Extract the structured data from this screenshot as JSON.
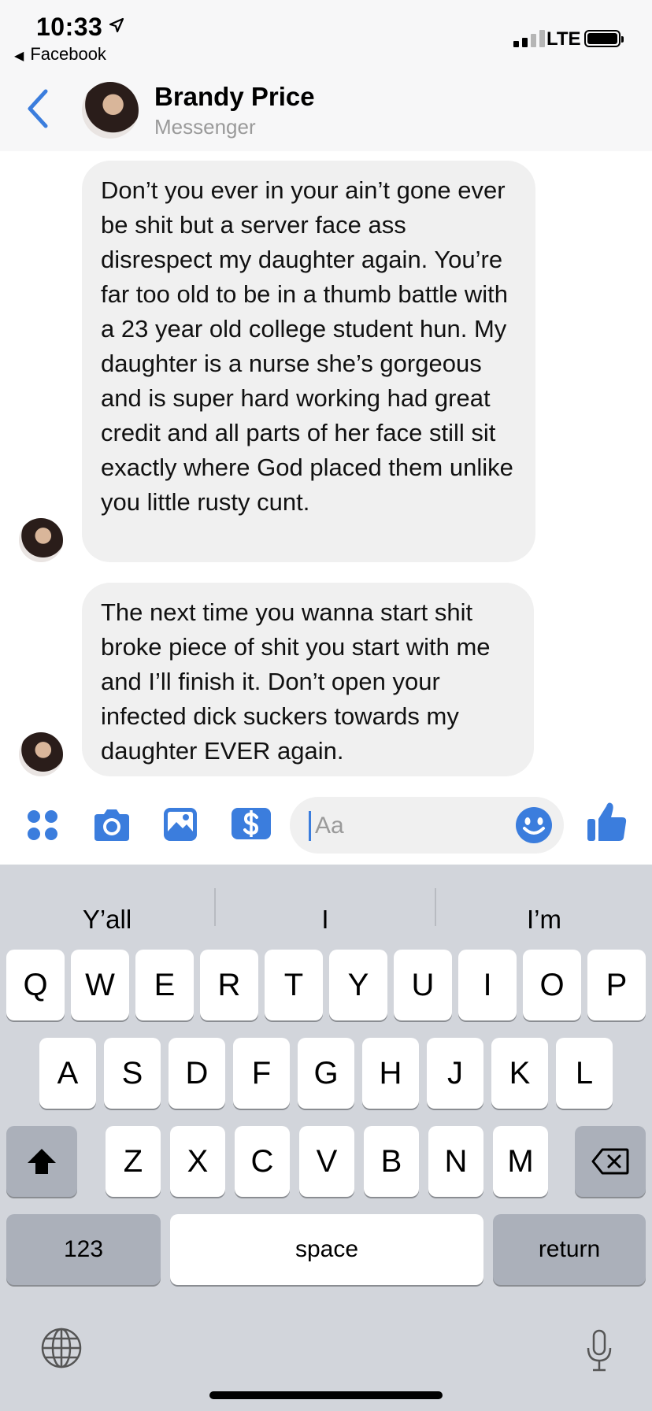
{
  "status_bar": {
    "time": "10:33",
    "back_app": "Facebook",
    "network": "LTE",
    "icons": [
      "location-arrow-icon",
      "signal-icon",
      "battery-icon"
    ]
  },
  "header": {
    "name": "Brandy Price",
    "subtitle": "Messenger",
    "back_icon": "chevron-left-icon"
  },
  "messages": [
    {
      "text": "Don’t you ever in your ain’t gone ever be shit but a server face ass disrespect my daughter again. You’re far too old to be in a thumb battle with a 23 year old college student hun. My daughter is a nurse she’s gorgeous and is super hard working had great credit and all parts of her face still sit exactly where God placed them unlike you little rusty cunt."
    },
    {
      "text": "The next time you wanna start shit broke piece of shit you start with me and I’ll finish it. Don’t open your infected dick suckers towards my daughter EVER again."
    }
  ],
  "composer": {
    "placeholder": "Aa",
    "icons": [
      "apps-grid-icon",
      "camera-icon",
      "photo-icon",
      "payment-icon",
      "emoji-icon",
      "thumbs-up-icon"
    ]
  },
  "keyboard": {
    "suggestions": [
      "Y’all",
      "I",
      "I’m"
    ],
    "row1": [
      "Q",
      "W",
      "E",
      "R",
      "T",
      "Y",
      "U",
      "I",
      "O",
      "P"
    ],
    "row2": [
      "A",
      "S",
      "D",
      "F",
      "G",
      "H",
      "J",
      "K",
      "L"
    ],
    "row3": [
      "Z",
      "X",
      "C",
      "V",
      "B",
      "N",
      "M"
    ],
    "numbers_label": "123",
    "space_label": "space",
    "return_label": "return"
  },
  "colors": {
    "accent": "#3b7ddd",
    "bubble": "#f0f0f0",
    "keyboard_bg": "#d2d5db"
  }
}
